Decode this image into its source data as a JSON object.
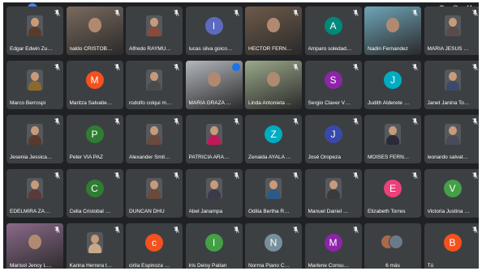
{
  "window_controls": {
    "zoom_in": "⊕",
    "zoom_out": "⊖",
    "close": "✕"
  },
  "tiles": [
    {
      "name": "Edgar Edwin Zubilet...",
      "kind": "photo",
      "color": "#5a3b2a",
      "muted": true
    },
    {
      "name": "naldo CRISTOBA...",
      "kind": "video",
      "color": "#7a6a5e",
      "muted": true
    },
    {
      "name": "Alfredo RAYMUNDO",
      "kind": "photo",
      "color": "#8a4a3a",
      "muted": true
    },
    {
      "name": "lucas silva goicochea",
      "kind": "letter",
      "letter": "l",
      "color": "#5c6bc0",
      "muted": true
    },
    {
      "name": "HECTOR FERNAND...",
      "kind": "video",
      "color": "#6d5a4a",
      "muted": true
    },
    {
      "name": "Amparo soledad Ate...",
      "kind": "letter",
      "letter": "A",
      "color": "#00897b",
      "muted": true
    },
    {
      "name": "Nadin Fernandez",
      "kind": "video",
      "color": "#6fa5b8",
      "muted": true
    },
    {
      "name": "MARIA JESUS BARR...",
      "kind": "photo",
      "color": "#5a4a4a",
      "muted": true
    },
    {
      "name": "Marco Berrospi",
      "kind": "photo",
      "color": "#8a6a2a",
      "muted": true
    },
    {
      "name": "Maritza Salvatierra ...",
      "kind": "letter",
      "letter": "M",
      "color": "#f4511e",
      "muted": true
    },
    {
      "name": "rodolfo colqui mateo",
      "kind": "photo",
      "color": "#4a4a4a",
      "muted": true
    },
    {
      "name": "MARIA GRAZA RIOS",
      "kind": "video",
      "color": "#b3b7bd",
      "muted": false,
      "speaking": true
    },
    {
      "name": "Linda Antonieta Ma...",
      "kind": "video",
      "color": "#9aa88a",
      "muted": true
    },
    {
      "name": "Sergio Claver VERÁS...",
      "kind": "letter",
      "letter": "S",
      "color": "#8e24aa",
      "muted": true
    },
    {
      "name": "Judith Alderete Ville...",
      "kind": "letter",
      "letter": "J",
      "color": "#00acc1",
      "muted": true
    },
    {
      "name": "Janet Janina Torres ...",
      "kind": "photo",
      "color": "#3a4a6a",
      "muted": true
    },
    {
      "name": "Jesenia Jessica Vega ...",
      "kind": "photo",
      "color": "#5a3a2a",
      "muted": true
    },
    {
      "name": "Peter VIA PAZ",
      "kind": "letter",
      "letter": "P",
      "color": "#2e7d32",
      "muted": true
    },
    {
      "name": "Alexander Smith OR...",
      "kind": "photo",
      "color": "#6a4a3a",
      "muted": true
    },
    {
      "name": "PATRICIA ARANCIBI...",
      "kind": "photo",
      "color": "#c2185b",
      "muted": true
    },
    {
      "name": "Zenaida AYALA ESPI...",
      "kind": "letter",
      "letter": "Z",
      "color": "#00acc1",
      "muted": true
    },
    {
      "name": "José Oropeza",
      "kind": "letter",
      "letter": "J",
      "color": "#3949ab",
      "muted": true
    },
    {
      "name": "MOISES FERNANDO ...",
      "kind": "photo",
      "color": "#2a2a3a",
      "muted": true
    },
    {
      "name": "leonardo salvatory a...",
      "kind": "photo",
      "color": "#4a4a5a",
      "muted": true
    },
    {
      "name": "EDELMIRA ZANABRI...",
      "kind": "photo",
      "color": "#5a3a3a",
      "muted": true
    },
    {
      "name": "Celia Cristobal Suarez",
      "kind": "letter",
      "letter": "C",
      "color": "#2e7d32",
      "muted": true
    },
    {
      "name": "DUNCAN DHU",
      "kind": "photo",
      "color": "#6a4a3a",
      "muted": true
    },
    {
      "name": "Abel Janampa",
      "kind": "photo",
      "color": "#3a3a4a",
      "muted": true
    },
    {
      "name": "Odilia Bertha Rosale...",
      "kind": "photo",
      "color": "#2a5a8a",
      "muted": true
    },
    {
      "name": "Manuel Daniel GUTIE...",
      "kind": "photo",
      "color": "#3a3a3a",
      "muted": true
    },
    {
      "name": "Elizabeth Torres",
      "kind": "letter",
      "letter": "E",
      "color": "#ec407a",
      "muted": true
    },
    {
      "name": "Victoria Justina FUS...",
      "kind": "letter",
      "letter": "V",
      "color": "#43a047",
      "muted": true
    },
    {
      "name": "Marisol Jency Lopez ...",
      "kind": "video",
      "color": "#8a6a8a",
      "muted": true
    },
    {
      "name": "Karina Herrera tufino",
      "kind": "photo",
      "color": "#c8a88a",
      "muted": true
    },
    {
      "name": "cirila Espinoza Suarez",
      "kind": "letter",
      "letter": "c",
      "color": "#f4511e",
      "muted": true
    },
    {
      "name": "Iris Deisy Paitan",
      "kind": "letter",
      "letter": "I",
      "color": "#43a047",
      "muted": true
    },
    {
      "name": "Norma Piano Cabello",
      "kind": "letter",
      "letter": "N",
      "color": "#78909c",
      "muted": true
    },
    {
      "name": "Marlene Consuelo B...",
      "kind": "letter",
      "letter": "M",
      "color": "#8e24aa",
      "muted": true
    },
    {
      "name": "6 más",
      "kind": "more",
      "color": "#a86a4a",
      "muted": false
    },
    {
      "name": "Tú",
      "kind": "letter",
      "letter": "B",
      "color": "#f4511e",
      "muted": true
    }
  ]
}
